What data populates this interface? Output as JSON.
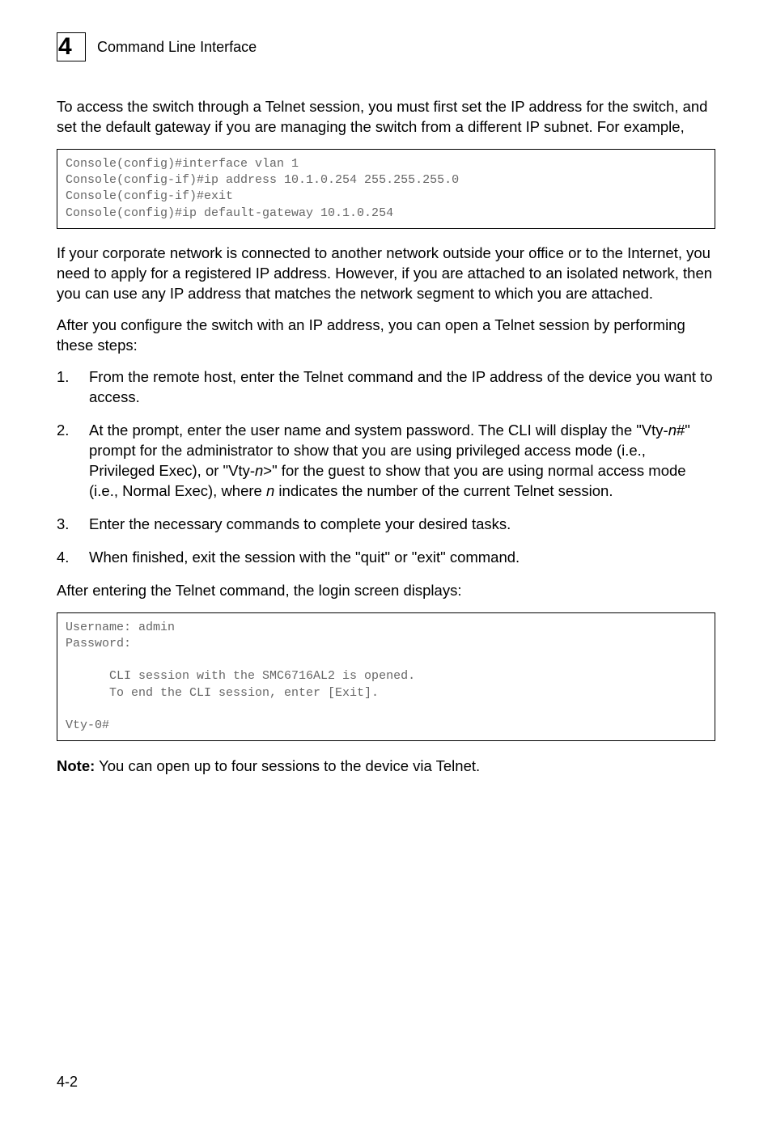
{
  "header": {
    "chapter_number": "4",
    "chapter_title": "Command Line Interface"
  },
  "para1": "To access the switch through a Telnet session, you must first set the IP address for the switch, and set the default gateway if you are managing the switch from a different IP subnet. For example,",
  "code1": "Console(config)#interface vlan 1\nConsole(config-if)#ip address 10.1.0.254 255.255.255.0\nConsole(config-if)#exit\nConsole(config)#ip default-gateway 10.1.0.254",
  "para2": "If your corporate network is connected to another network outside your office or to the Internet, you need to apply for a registered IP address. However, if you are attached to an isolated network, then you can use any IP address that matches the network segment to which you are attached.",
  "para3": "After you configure the switch with an IP address, you can open a Telnet session by performing these steps:",
  "steps": {
    "s1": "From the remote host, enter the Telnet command and the IP address of the device you want to access.",
    "s2_a": "At the prompt, enter the user name and system password. The CLI will display the \"Vty-",
    "s2_b": "n",
    "s2_c": "#\" prompt for the administrator to show that you are using privileged access mode (i.e., Privileged Exec), or \"Vty-",
    "s2_d": "n",
    "s2_e": ">\" for the guest to show that you are using normal access mode (i.e., Normal Exec), where ",
    "s2_f": "n",
    "s2_g": " indicates the number of the current Telnet session.",
    "s3": "Enter the necessary commands to complete your desired tasks.",
    "s4": "When finished, exit the session with the \"quit\" or \"exit\" command."
  },
  "para4": "After entering the Telnet command, the login screen displays:",
  "code2": "Username: admin\nPassword:\n\n      CLI session with the SMC6716AL2 is opened.\n      To end the CLI session, enter [Exit].\n\nVty-0#",
  "note_label": "Note:",
  "note_text": "  You can open up to four sessions to the device via Telnet.",
  "page_number": "4-2"
}
